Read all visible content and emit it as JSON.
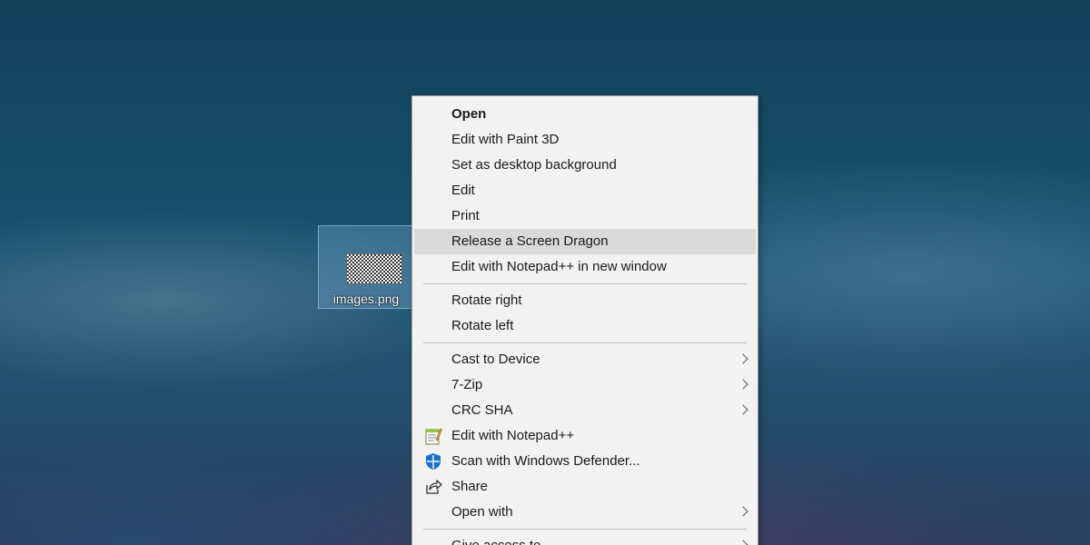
{
  "desktop": {
    "file": {
      "name": "images.png"
    }
  },
  "context_menu": {
    "items": [
      {
        "label": "Open"
      },
      {
        "label": "Edit with Paint 3D"
      },
      {
        "label": "Set as desktop background"
      },
      {
        "label": "Edit"
      },
      {
        "label": "Print"
      },
      {
        "label": "Release a Screen Dragon"
      },
      {
        "label": "Edit with Notepad++ in new window"
      },
      {
        "label": "Rotate right"
      },
      {
        "label": "Rotate left"
      },
      {
        "label": "Cast to Device"
      },
      {
        "label": "7-Zip"
      },
      {
        "label": "CRC SHA"
      },
      {
        "label": "Edit with Notepad++",
        "icon": "notepad-plus-plus-icon"
      },
      {
        "label": "Scan with Windows Defender...",
        "icon": "windows-defender-icon"
      },
      {
        "label": "Share",
        "icon": "share-icon"
      },
      {
        "label": "Open with"
      },
      {
        "label": "Give access to"
      }
    ],
    "highlighted_index": 5
  },
  "colors": {
    "menu_background": "#f2f2f2",
    "menu_highlight": "#dadada",
    "defender_blue": "#1a73c8"
  }
}
